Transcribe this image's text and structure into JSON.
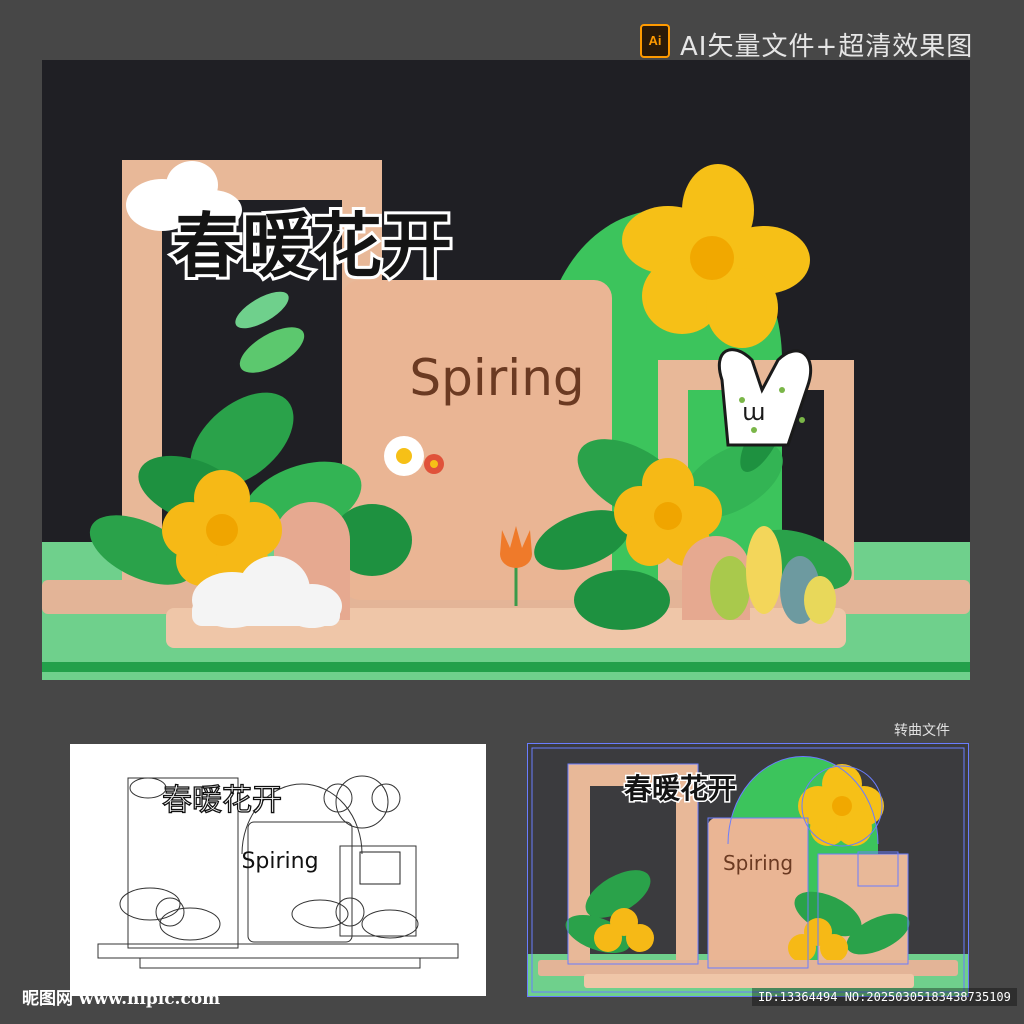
{
  "header": {
    "badge_label": "Ai",
    "title": "AI矢量文件+超清效果图"
  },
  "artwork": {
    "headline": "春暖花开",
    "subtitle": "Spiring"
  },
  "curve_caption": "转曲文件",
  "outline_view": {
    "headline": "春暖花开",
    "subtitle": "Spiring"
  },
  "preview_view": {
    "headline": "春暖花开",
    "subtitle": "Spiring"
  },
  "watermark": {
    "site_logo": "昵图网 www.nipic.com",
    "image_id": "ID:13364494 NO:20250305183438735109"
  },
  "colors": {
    "background": "#474747",
    "art_background": "#1f1f24",
    "frame_peach": "#e8b898",
    "leaf_green": "#2aa24a",
    "flower_yellow": "#f6b916",
    "selection_blue": "#6a7dff"
  }
}
